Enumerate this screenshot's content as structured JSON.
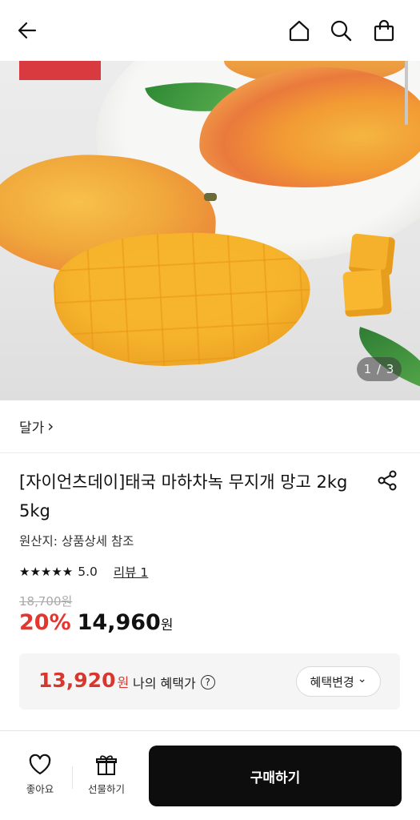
{
  "header": {
    "icons": [
      "back-arrow-icon",
      "home-icon",
      "search-icon",
      "shopping-bag-icon"
    ]
  },
  "gallery": {
    "pager": "1 / 3",
    "current": 1,
    "total": 3
  },
  "brand": {
    "name": "달가",
    "chevron": "›"
  },
  "product": {
    "title": "[자이언츠데이]태국 마하차녹 무지개 망고 2kg 5kg",
    "origin": "원산지: 상품상세 참조",
    "rating_stars": "★★★★★",
    "rating_value": "5.0",
    "review_link": "리뷰 1",
    "original_price": "18,700원",
    "discount": "20%",
    "price": "14,960",
    "price_unit": "원"
  },
  "benefit": {
    "price": "13,920",
    "price_unit": "원",
    "label": "나의 혜택가",
    "help_icon": "?",
    "change_button": "혜택변경",
    "change_chevron": "⌄"
  },
  "bottom_bar": {
    "like_label": "좋아요",
    "gift_label": "선물하기",
    "buy_button": "구매하기"
  },
  "colors": {
    "accent_red": "#e5352f",
    "buy_button_bg": "#0d0d0d",
    "benefit_bg": "#f5f5f5"
  }
}
